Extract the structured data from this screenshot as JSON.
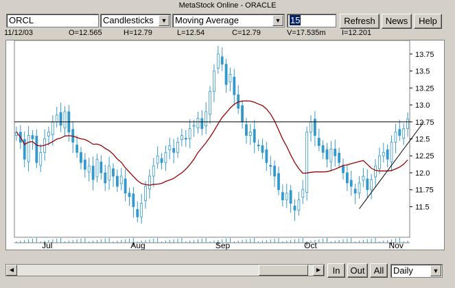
{
  "window": {
    "title": "MetaStock Online - ORACLE"
  },
  "toolbar": {
    "symbol": "ORCL",
    "chart_type": "Candlesticks",
    "indicator": "Moving Average",
    "period": "15",
    "refresh_label": "Refresh",
    "news_label": "News",
    "help_label": "Help"
  },
  "info": {
    "date": "11/12/03",
    "open": "O=12.565",
    "high": "H=12.79",
    "low": "L=12.54",
    "close": "C=12.79",
    "volume": "V=17.535m",
    "indicator": "I=12.201"
  },
  "bottom": {
    "in_label": "In",
    "out_label": "Out",
    "all_label": "All",
    "period_select": "Daily"
  },
  "colors": {
    "candle": "#3399cc",
    "moving_average": "#990000",
    "trendline": "#000000"
  },
  "chart_data": {
    "type": "candlestick",
    "ylim": [
      11.05,
      13.95
    ],
    "yticks": [
      "13.75",
      "13.5",
      "13.25",
      "13.0",
      "12.75",
      "12.5",
      "12.25",
      "12.0",
      "11.75",
      "11.5"
    ],
    "yticks_num": [
      13.75,
      13.5,
      13.25,
      13.0,
      12.75,
      12.5,
      12.25,
      12.0,
      11.75,
      11.5
    ],
    "xticks": [
      {
        "label": "Jul",
        "index": 7
      },
      {
        "label": "Aug",
        "index": 29
      },
      {
        "label": "Sep",
        "index": 50
      },
      {
        "label": "Oct",
        "index": 72
      },
      {
        "label": "Nov",
        "index": 93
      }
    ],
    "horizontal_line": 12.75,
    "trendline": [
      {
        "index": 85,
        "value": 11.47
      },
      {
        "index": 101,
        "value": 12.75
      }
    ],
    "closes": [
      12.6,
      12.45,
      12.2,
      12.55,
      12.5,
      12.15,
      12.3,
      12.5,
      12.6,
      12.75,
      12.85,
      12.7,
      12.9,
      12.6,
      12.45,
      12.3,
      12.15,
      12.05,
      12.1,
      11.9,
      12.2,
      12.0,
      11.85,
      12.1,
      11.95,
      11.8,
      11.95,
      11.7,
      11.65,
      11.5,
      11.35,
      11.55,
      11.8,
      11.95,
      12.1,
      12.25,
      12.15,
      12.3,
      12.4,
      12.3,
      12.45,
      12.55,
      12.5,
      12.65,
      12.7,
      12.8,
      12.65,
      12.9,
      13.2,
      13.5,
      13.75,
      13.6,
      13.3,
      13.45,
      13.15,
      12.95,
      12.75,
      12.55,
      12.6,
      12.45,
      12.4,
      12.3,
      12.15,
      12.1,
      11.95,
      11.75,
      11.6,
      11.7,
      11.55,
      11.45,
      11.6,
      11.75,
      12.6,
      12.75,
      12.55,
      12.4,
      12.3,
      12.2,
      12.35,
      12.25,
      12.15,
      12.0,
      11.85,
      11.8,
      11.7,
      11.85,
      11.95,
      11.75,
      11.9,
      12.1,
      12.25,
      12.3,
      12.2,
      12.45,
      12.6,
      12.55,
      12.65,
      12.79
    ]
  }
}
